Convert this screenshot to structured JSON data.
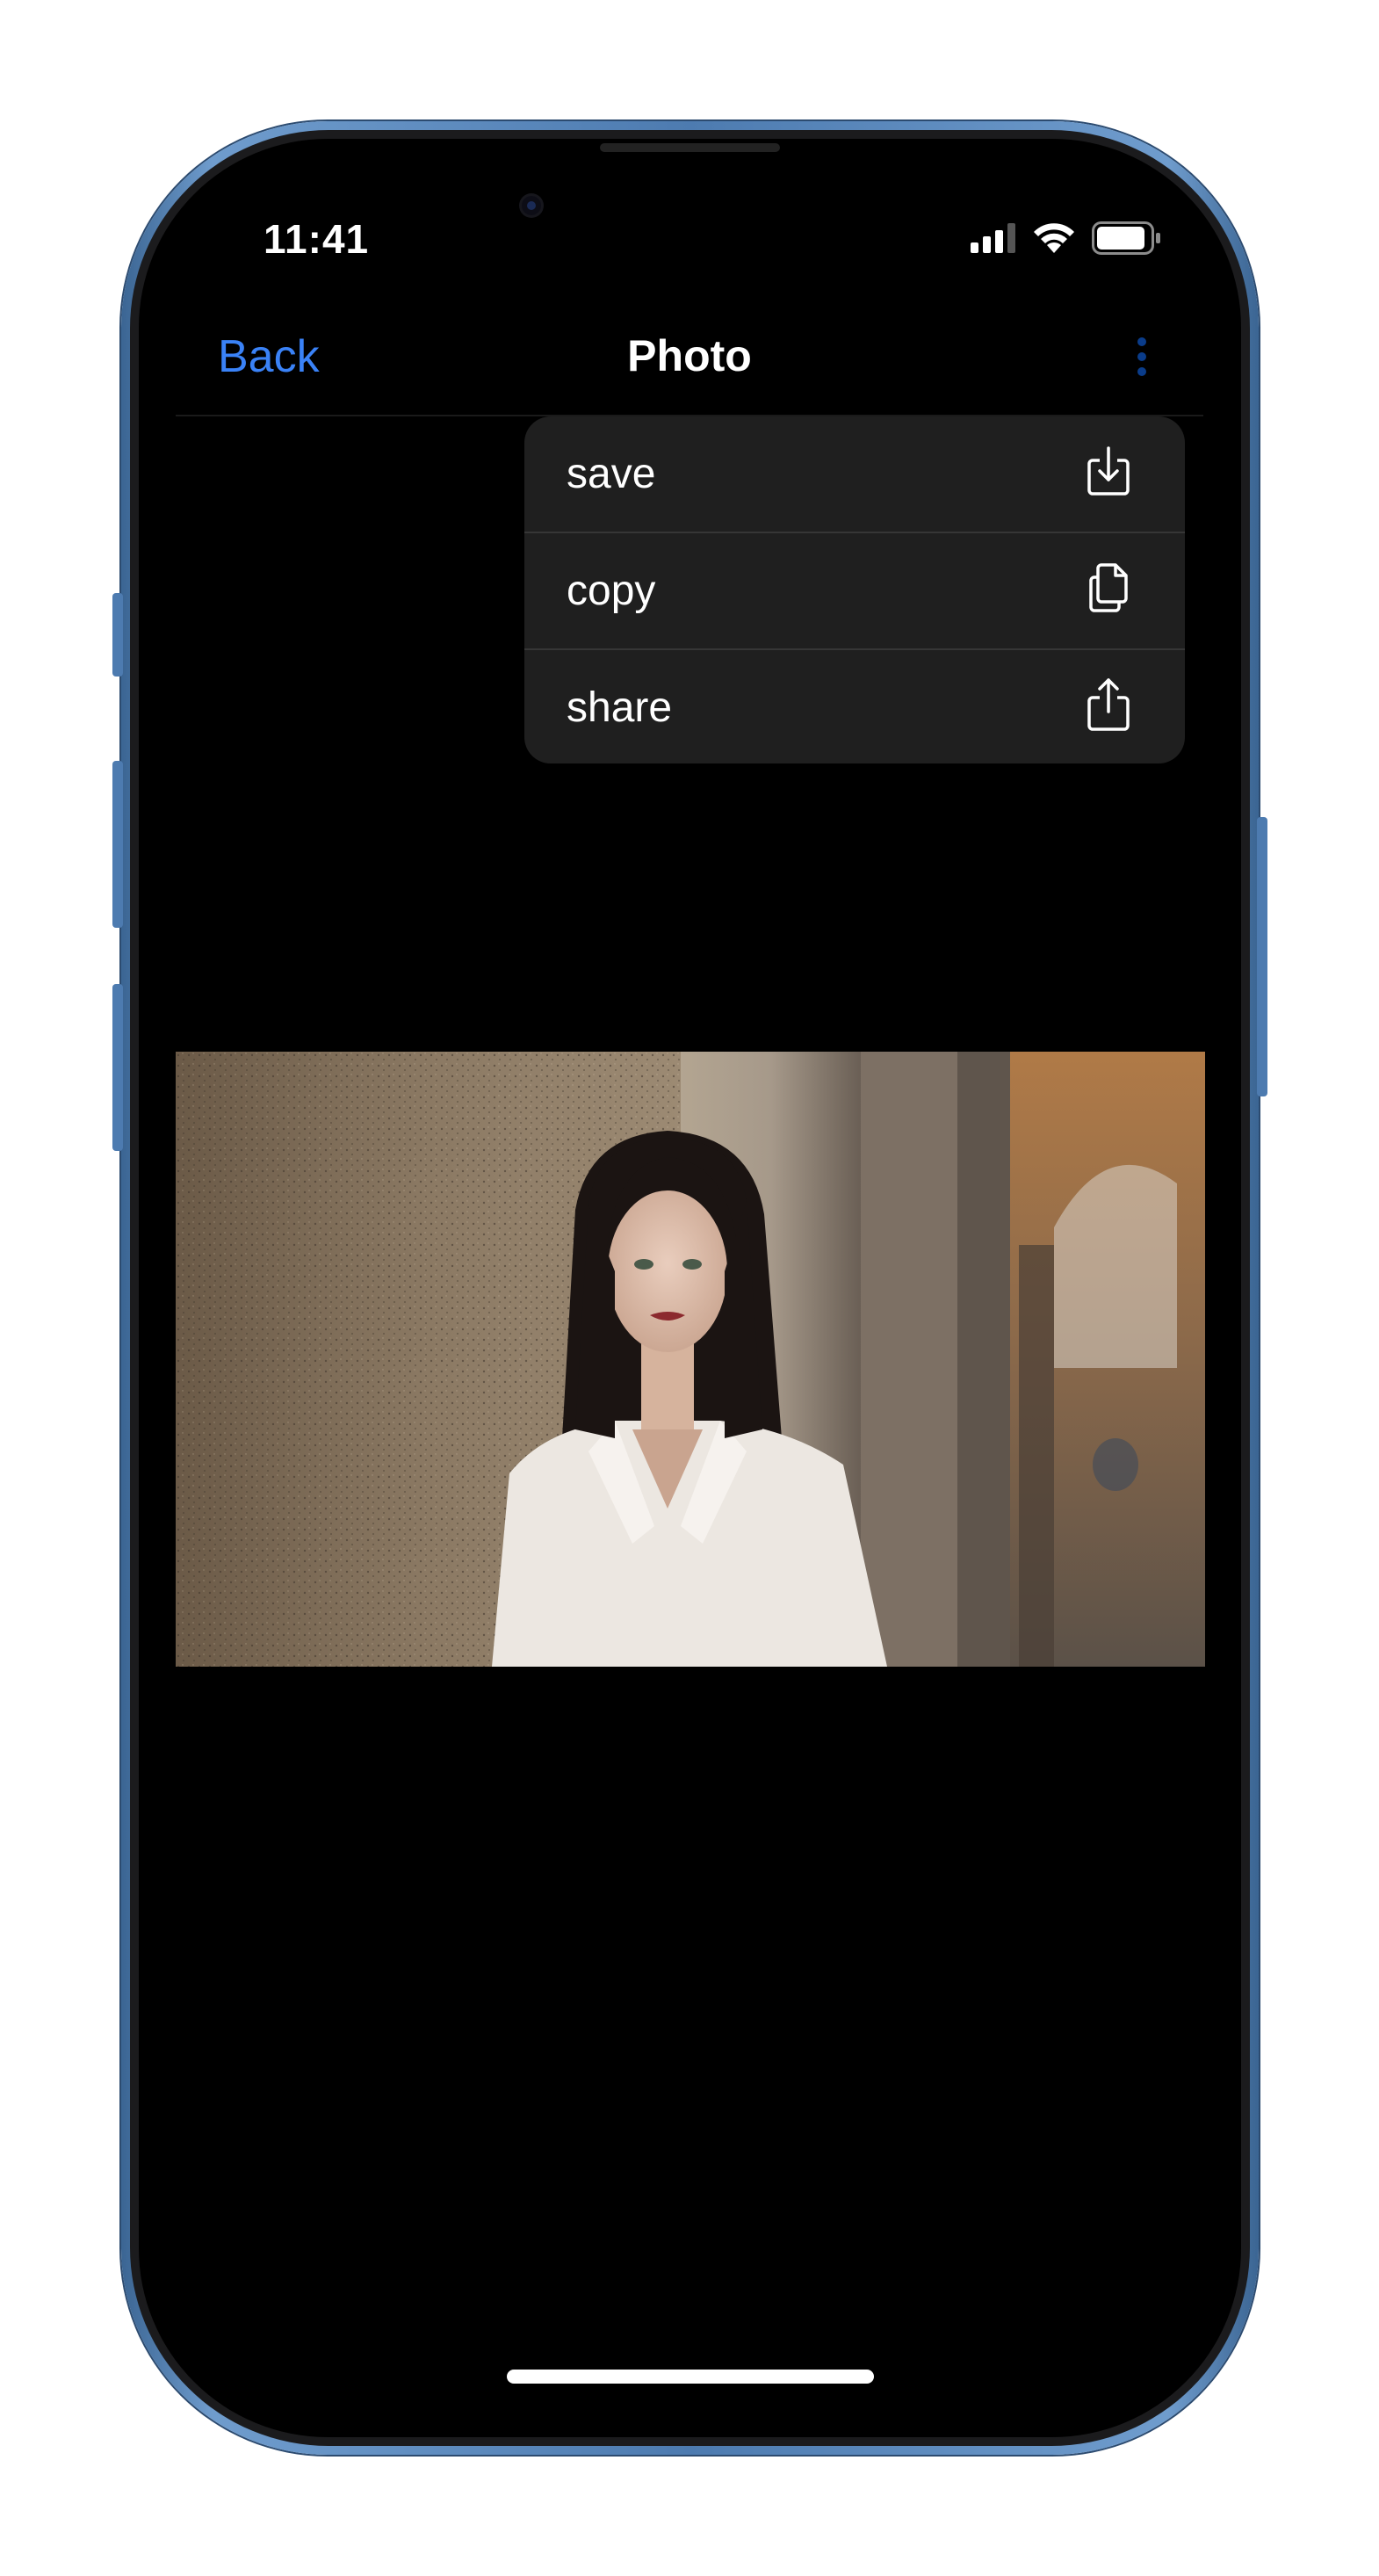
{
  "status_bar": {
    "time": "11:41",
    "icons": [
      "cellular-signal-icon",
      "wifi-icon",
      "battery-icon"
    ]
  },
  "nav": {
    "back_label": "Back",
    "title": "Photo",
    "more_icon": "more-vertical-icon"
  },
  "menu": {
    "items": [
      {
        "label": "save",
        "icon": "download-icon"
      },
      {
        "label": "copy",
        "icon": "copy-icon"
      },
      {
        "label": "share",
        "icon": "share-icon"
      }
    ]
  },
  "photo": {
    "subject": "portrait of a woman with dark hair in a white shirt leaning against a stone column"
  },
  "colors": {
    "accent": "#3a82f7",
    "menu_background": "#1f1f1f",
    "screen_background": "#000000",
    "frame": "#4d7bb0"
  }
}
